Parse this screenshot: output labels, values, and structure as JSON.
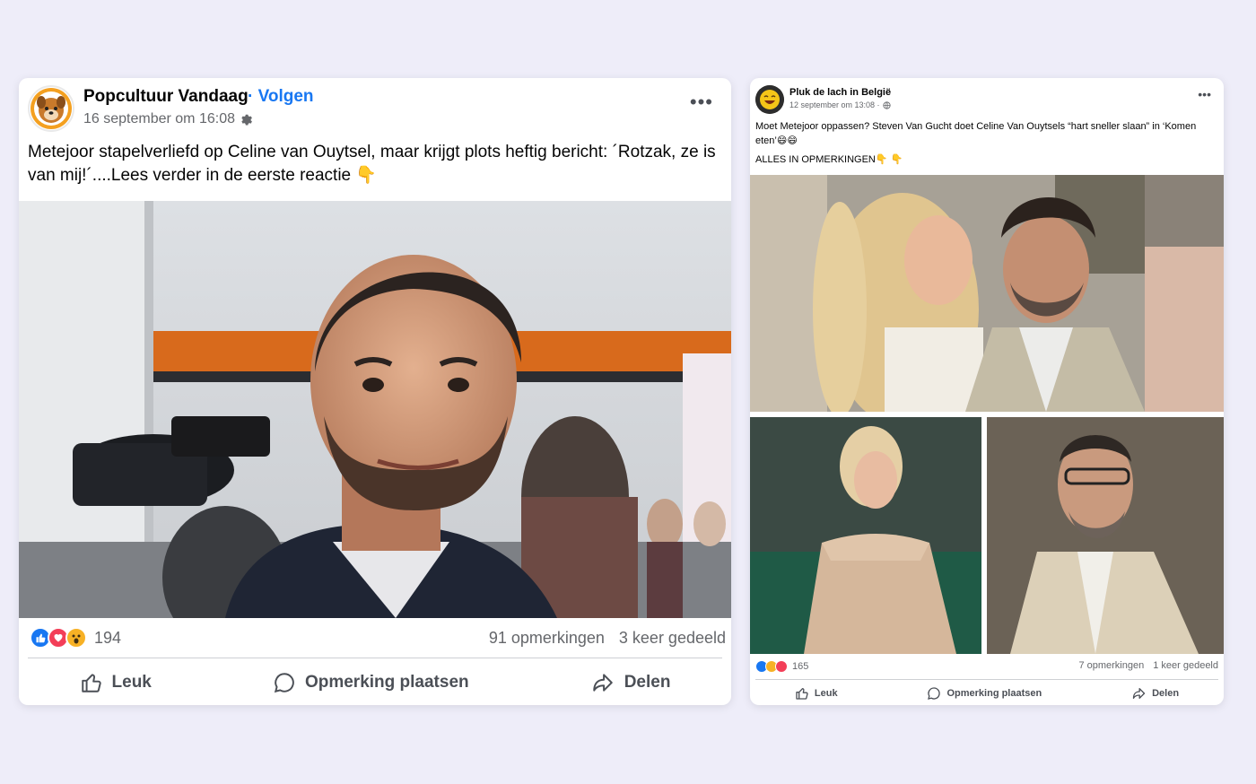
{
  "posts": [
    {
      "page_name": "Popcultuur Vandaag",
      "separator": "·",
      "follow_label": "Volgen",
      "timestamp": "16 september om 16:08",
      "audience_icon": "gear-icon",
      "caption": "Metejoor stapelverliefd op Celine van Ouytsel, maar krijgt plots heftig bericht: ´Rotzak, ze is van mij!´....Lees verder in de eerste reactie 👇",
      "reaction_icons": [
        "like-icon",
        "love-icon",
        "wow-icon"
      ],
      "reaction_count": "194",
      "comments": "91 opmerkingen",
      "shares": "3 keer gedeeld",
      "actions": {
        "like": "Leuk",
        "comment": "Opmerking plaatsen",
        "share": "Delen"
      }
    },
    {
      "page_name": "Pluk de lach in België",
      "timestamp": "12 september om 13:08 ·",
      "audience_icon": "globe-icon",
      "caption": "Moet Metejoor oppassen? Steven Van Gucht doet Celine Van Ouytsels “hart sneller slaan” in ‘Komen eten’😄😄",
      "caption2": "ALLES IN OPMERKINGEN👇 👇",
      "reaction_icons": [
        "like-icon",
        "haha-icon",
        "love-icon"
      ],
      "reaction_count": "165",
      "comments": "7 opmerkingen",
      "shares": "1 keer gedeeld",
      "actions": {
        "like": "Leuk",
        "comment": "Opmerking plaatsen",
        "share": "Delen"
      }
    }
  ],
  "colors": {
    "background": "#eeedf9",
    "link_blue": "#1877f2",
    "muted_text": "#65676b",
    "like_blue": "#1877f2",
    "love_red": "#f33e58",
    "wow_yellow": "#f7b125"
  }
}
